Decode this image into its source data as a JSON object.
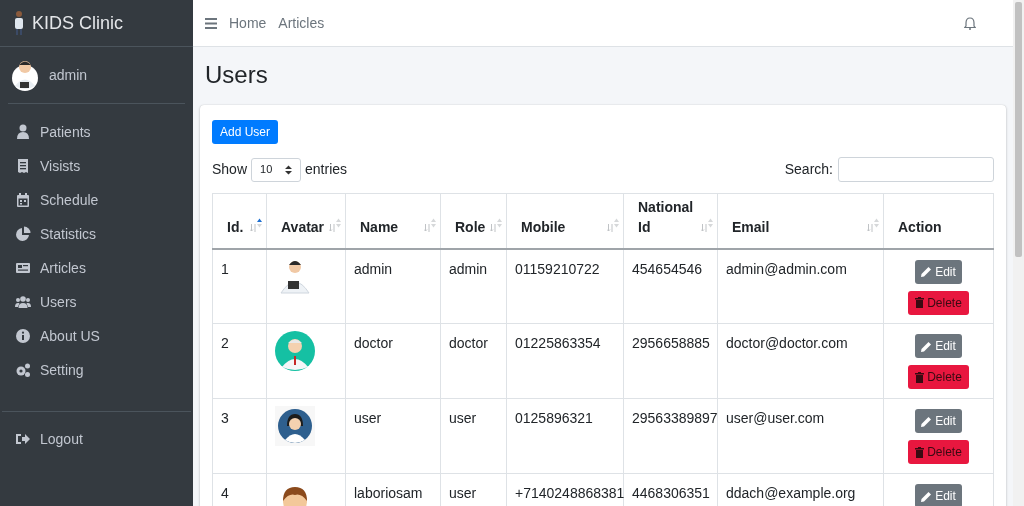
{
  "brand": {
    "title": "KIDS Clinic"
  },
  "user_panel": {
    "name": "admin"
  },
  "sidebar": {
    "items": [
      {
        "label": "Patients",
        "selected": false
      },
      {
        "label": "Visists",
        "selected": false
      },
      {
        "label": "Schedule",
        "selected": false
      },
      {
        "label": "Statistics",
        "selected": false
      },
      {
        "label": "Articles",
        "selected": false
      },
      {
        "label": "Users",
        "selected": false
      },
      {
        "label": "About US",
        "selected": false
      },
      {
        "label": "Setting",
        "selected": false
      }
    ],
    "footer_items": [
      {
        "label": "Logout"
      }
    ]
  },
  "navbar": {
    "links": [
      "Home",
      "Articles"
    ]
  },
  "page_title": "Users",
  "card": {
    "add_button": "Add User",
    "length": {
      "before": "Show",
      "value": "10",
      "after": "entries"
    },
    "search": {
      "label": "Search:"
    },
    "table": {
      "columns": [
        {
          "label": "Id.",
          "sortable": true,
          "sorted": true
        },
        {
          "label": "Avatar",
          "sortable": true,
          "sorted": false
        },
        {
          "label": "Name",
          "sortable": true,
          "sorted": false
        },
        {
          "label": "Role",
          "sortable": true,
          "sorted": false
        },
        {
          "label": "Mobile",
          "sortable": true,
          "sorted": false
        },
        {
          "label": "National Id",
          "sortable": true,
          "sorted": false
        },
        {
          "label": "Email",
          "sortable": true,
          "sorted": false
        },
        {
          "label": "Action",
          "sortable": false
        }
      ],
      "rows": [
        {
          "id": "1",
          "name": "admin",
          "role": "admin",
          "mobile": "01159210722",
          "national_id": "454654546",
          "email": "admin@admin.com",
          "actions": [
            {
              "kind": "edit",
              "label": "Edit"
            },
            {
              "kind": "delete",
              "label": "Delete"
            }
          ]
        },
        {
          "id": "2",
          "name": "doctor",
          "role": "doctor",
          "mobile": "01225863354",
          "national_id": "2956658885",
          "email": "doctor@doctor.com",
          "actions": [
            {
              "kind": "edit",
              "label": "Edit"
            },
            {
              "kind": "delete",
              "label": "Delete"
            }
          ]
        },
        {
          "id": "3",
          "name": "user",
          "role": "user",
          "mobile": "0125896321",
          "national_id": "29563389897",
          "email": "user@user.com",
          "actions": [
            {
              "kind": "edit",
              "label": "Edit"
            },
            {
              "kind": "delete",
              "label": "Delete"
            }
          ]
        },
        {
          "id": "4",
          "name": "laboriosam",
          "role": "user",
          "mobile": "+7140248868381",
          "national_id": "4468306351",
          "email": "ddach@example.org",
          "actions": [
            {
              "kind": "edit",
              "label": "Edit"
            }
          ]
        }
      ]
    }
  }
}
